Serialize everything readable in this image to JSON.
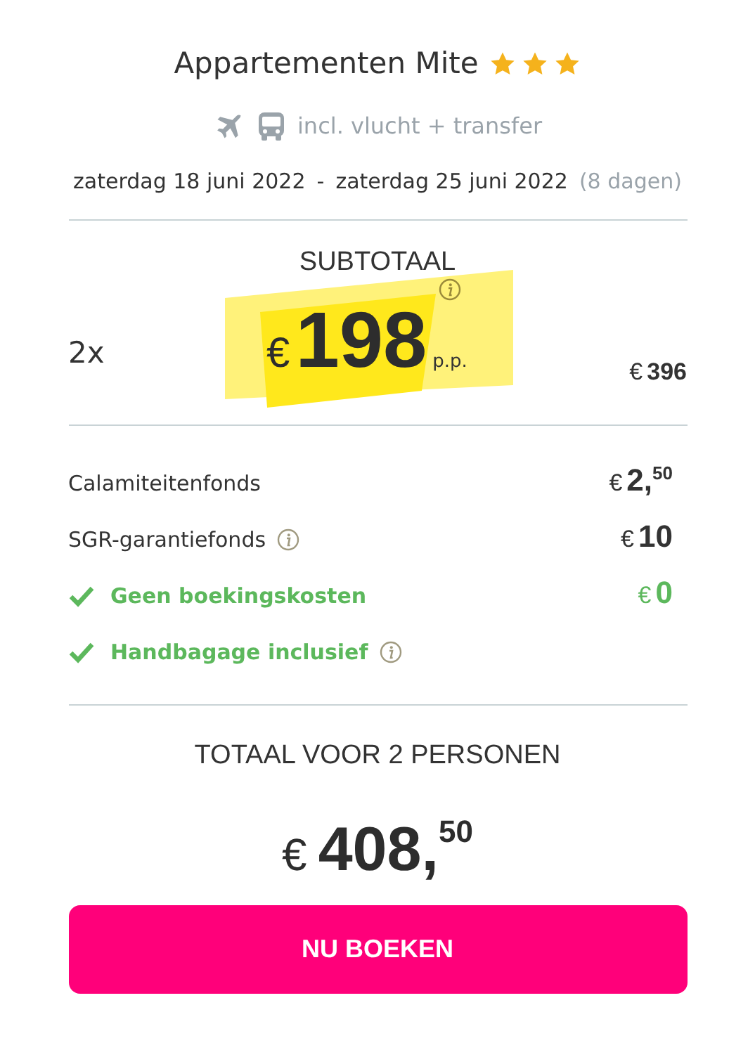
{
  "hotel": {
    "name": "Appartementen Mite",
    "stars": 3
  },
  "transport": {
    "text": "incl. vlucht + transfer"
  },
  "dates": {
    "from": "zaterdag 18 juni 2022",
    "separator": "-",
    "to": "zaterdag 25 juni 2022",
    "duration": "(8 dagen)"
  },
  "subtotal": {
    "heading": "SUBTOTAAL",
    "quantity": "2x",
    "currency": "€",
    "price": "198",
    "per": "p.p.",
    "info": true,
    "total_currency": "€",
    "total": "396"
  },
  "fees": [
    {
      "kind": "fee",
      "label": "Calamiteitenfonds",
      "currency": "€",
      "amount": "2,$^{50}$",
      "info": false
    },
    {
      "kind": "fee",
      "label": "SGR-garantiefonds",
      "currency": "€",
      "amount": "10",
      "info": true
    },
    {
      "kind": "included",
      "label": "Geen boekingskosten",
      "currency": "€",
      "amount": "0",
      "info": false
    },
    {
      "kind": "included",
      "label": "Handbagage inclusief",
      "info": true
    }
  ],
  "total": {
    "heading": "TOTAAL VOOR 2 PERSONEN",
    "currency": "€",
    "amount": "408,$^{50}$"
  },
  "button": {
    "label": "NU BOEKEN"
  }
}
